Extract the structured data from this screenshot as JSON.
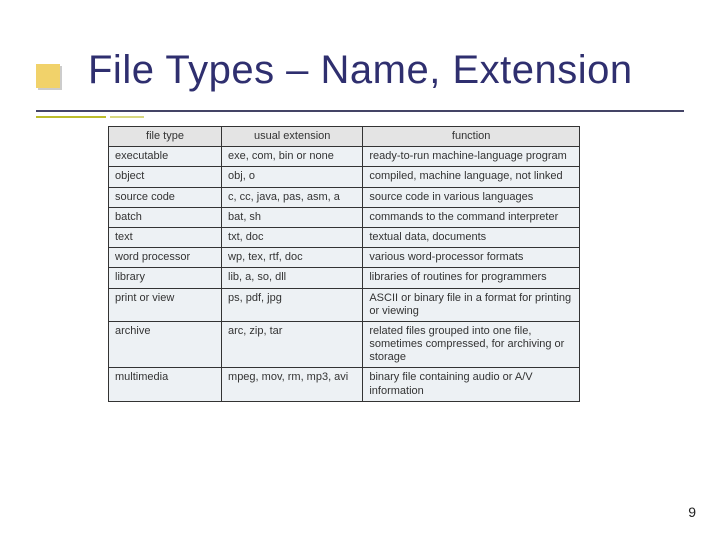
{
  "title": "File Types – Name, Extension",
  "page_number": "9",
  "table": {
    "headers": {
      "type": "file type",
      "ext": "usual extension",
      "func": "function"
    },
    "rows": [
      {
        "type": "executable",
        "ext": "exe, com, bin or none",
        "func": "ready-to-run machine-language program"
      },
      {
        "type": "object",
        "ext": "obj, o",
        "func": "compiled, machine language, not linked"
      },
      {
        "type": "source code",
        "ext": "c, cc, java, pas, asm, a",
        "func": "source code in various languages"
      },
      {
        "type": "batch",
        "ext": "bat, sh",
        "func": "commands to the command interpreter"
      },
      {
        "type": "text",
        "ext": "txt, doc",
        "func": "textual data, documents"
      },
      {
        "type": "word processor",
        "ext": "wp, tex, rtf, doc",
        "func": "various word-processor formats"
      },
      {
        "type": "library",
        "ext": "lib, a, so, dll",
        "func": "libraries of routines for programmers"
      },
      {
        "type": "print or view",
        "ext": "ps, pdf, jpg",
        "func": "ASCII or binary file in a format for printing or viewing"
      },
      {
        "type": "archive",
        "ext": "arc, zip, tar",
        "func": "related files grouped into one file, sometimes compressed, for archiving or storage"
      },
      {
        "type": "multimedia",
        "ext": "mpeg, mov, rm, mp3, avi",
        "func": "binary file containing audio or A/V information"
      }
    ]
  }
}
